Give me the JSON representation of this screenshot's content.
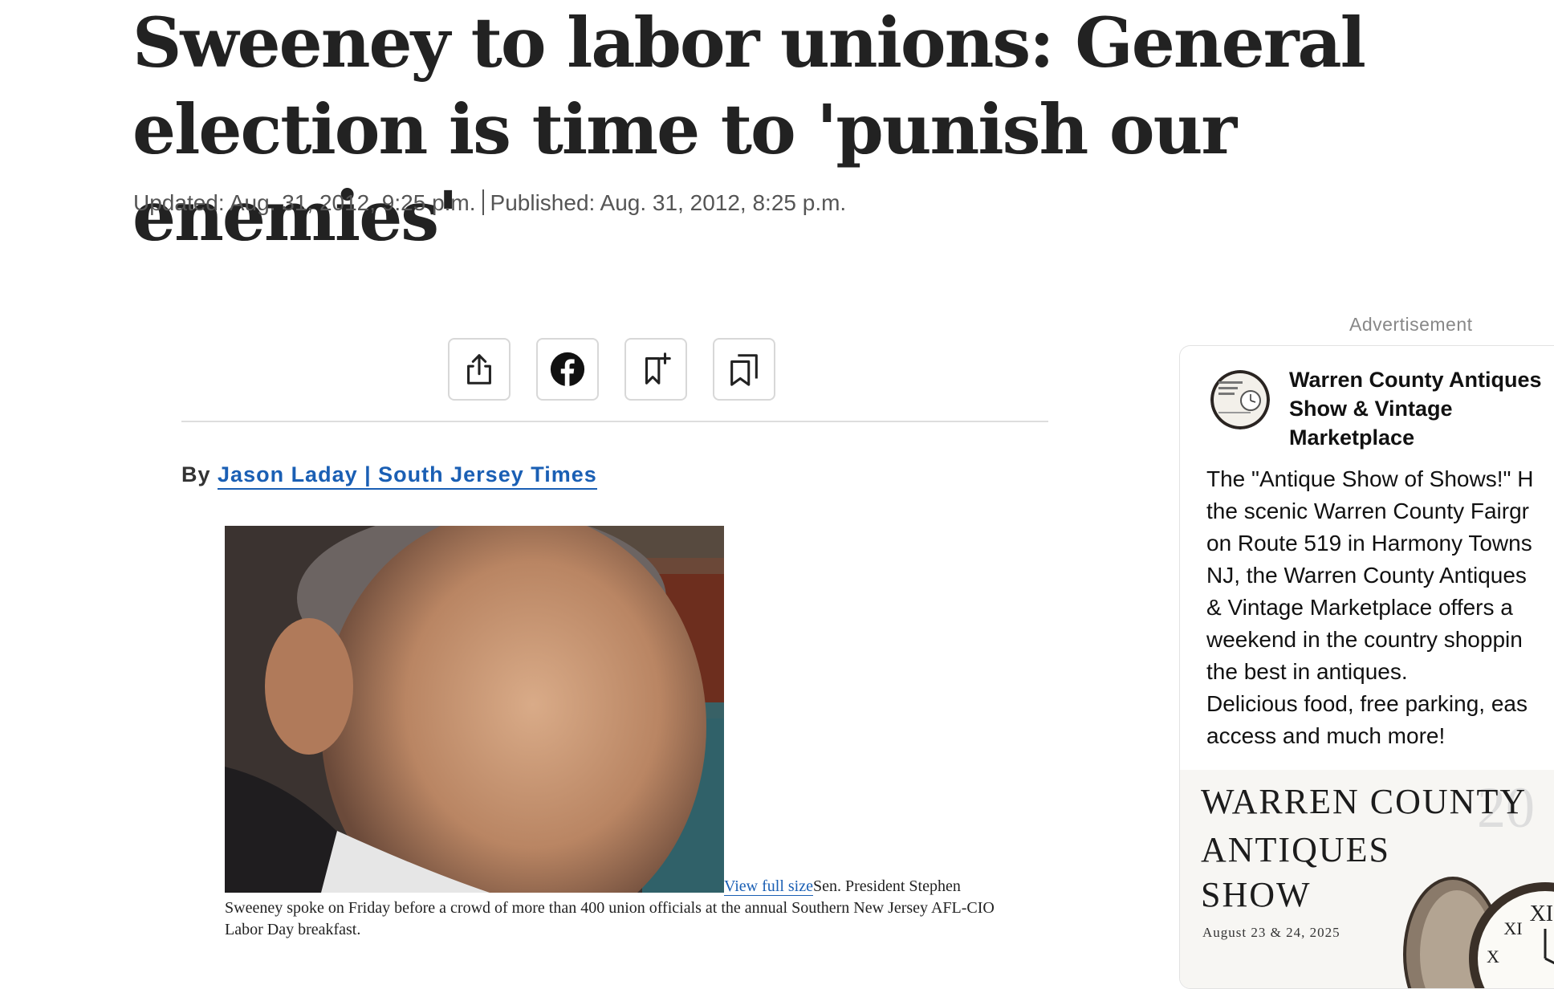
{
  "article": {
    "headline": "Sweeney to labor unions: General election is time to 'punish our enemies'",
    "updated": "Updated: Aug. 31, 2012, 9:25 p.m.",
    "published": "Published: Aug. 31, 2012, 8:25 p.m.",
    "byline_prefix": "By",
    "byline_author": "Jason Laday | South Jersey Times",
    "photo_link": "View full size",
    "caption": "Sen. President Stephen Sweeney spoke on Friday before a crowd of more than 400 union officials at the annual Southern New Jersey AFL-CIO Labor Day breakfast."
  },
  "share_bar": {
    "icons": [
      "share-icon",
      "facebook-icon",
      "bookmark-add-icon",
      "saved-bookmarks-icon"
    ]
  },
  "ad": {
    "label": "Advertisement",
    "title": "Warren County Antiques Show & Vintage Marketplace",
    "body_lines": [
      "The \"Antique Show of Shows!\" H",
      "the scenic Warren County Fairgr",
      "on Route 519 in Harmony Towns",
      "NJ, the Warren County Antiques",
      "& Vintage Marketplace offers a",
      "weekend in the country shoppin",
      "the best in antiques."
    ],
    "body_lines_2": [
      "Delicious food, free parking, eas",
      "access and much more!"
    ],
    "image_line_1": "WARREN  COUNTY",
    "image_line_2": "ANTIQUES",
    "image_line_3": "SHOW",
    "image_date": "August  23  &  24,  2025",
    "avatar_text": "WARREN COUNTY ANTIQUES SHOW"
  },
  "colors": {
    "link": "#1a5fb4",
    "headline": "#222222",
    "meta": "#555555"
  }
}
